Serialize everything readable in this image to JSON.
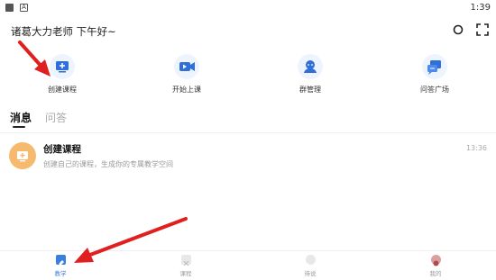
{
  "status_bar": {
    "time": "1:39",
    "icon_a": "A"
  },
  "header": {
    "greeting": "诸葛大力老师 下午好~"
  },
  "quick_actions": [
    {
      "label": "创建课程",
      "icon": "screen-plus-icon"
    },
    {
      "label": "开始上课",
      "icon": "video-play-icon"
    },
    {
      "label": "群管理",
      "icon": "group-icon"
    },
    {
      "label": "问答广场",
      "icon": "chat-icon"
    }
  ],
  "tabs": [
    {
      "label": "消息",
      "active": true
    },
    {
      "label": "问答",
      "active": false
    }
  ],
  "messages": [
    {
      "title": "创建课程",
      "subtitle": "创建自己的课程，生成你的专属教学空间",
      "time": "13:36"
    }
  ],
  "bottom_nav": [
    {
      "label": "教学",
      "active": true
    },
    {
      "label": "课程",
      "active": false
    },
    {
      "label": "待说",
      "active": false
    },
    {
      "label": "我的",
      "active": false
    }
  ],
  "colors": {
    "accent": "#3a7fe0",
    "icon_bg": "#eef4fd",
    "message_avatar": "#f5ba6e",
    "annotation_arrow": "#e02020"
  }
}
